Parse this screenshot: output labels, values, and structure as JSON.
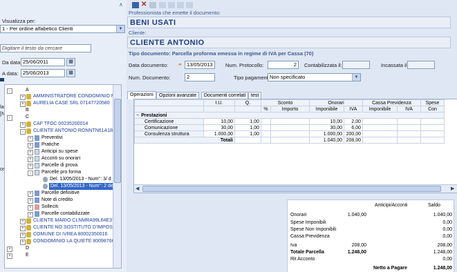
{
  "left": {
    "view_label": "Visualizza per:",
    "view_value": "1 - Per ordine alfabetico Clienti",
    "search_placeholder": "Digitare il testo da cercare",
    "from_label": "Da data:",
    "from_value": "25/06/2011",
    "to_label": "A data:",
    "to_value": "25/06/2013",
    "cut_labels": [
      "la",
      "[N",
      "oso"
    ],
    "tree": [
      {
        "text": "A",
        "blue": false
      },
      {
        "text": "AMMINISTRATORE CONDOMINIO M",
        "blue": true
      },
      {
        "text": "AURELIA CASE SRL  07147720580",
        "blue": true
      },
      {
        "text": "B",
        "blue": false
      },
      {
        "text": "C",
        "blue": false
      },
      {
        "text": "CAF TFDC  00235200014",
        "blue": true
      },
      {
        "text": "CLIENTE ANTONIO  RONNTN61A18",
        "blue": true
      },
      {
        "text": "Preventivi",
        "blue": false
      },
      {
        "text": "Pratiche",
        "blue": false
      },
      {
        "text": "Anticipi su spese",
        "blue": false
      },
      {
        "text": "Acconti su onorari",
        "blue": false
      },
      {
        "text": "Parcelle di prova",
        "blue": false
      },
      {
        "text": "Parcelle pro forma",
        "blue": false
      },
      {
        "text": "Del. 13/05/2013 - Num°: 3/ d",
        "blue": false
      },
      {
        "text": "Del. 13/05/2013 - Num°: 2 de",
        "blue": false,
        "selected": true
      },
      {
        "text": "Parcelle definitive",
        "blue": false
      },
      {
        "text": "Note di credito",
        "blue": false
      },
      {
        "text": "Solleciti",
        "blue": false
      },
      {
        "text": "Parcelle contabilizzate",
        "blue": false
      },
      {
        "text": "CLIENTE MARIO  CLNMRA99L64E37",
        "blue": true
      },
      {
        "text": "CLIENTE NO SOSTITUTO D'IMPOST",
        "blue": true
      },
      {
        "text": "COMUNE DI IVREA  80002350016",
        "blue": true
      },
      {
        "text": "CONDOMINIO LA QUIETE  8009876C",
        "blue": true
      },
      {
        "text": "D",
        "blue": false
      },
      {
        "text": "E",
        "blue": false
      }
    ]
  },
  "right": {
    "issuer_label": "Professionista che emette il documento:",
    "issuer_value": "BENI USATI",
    "client_label": "Cliente:",
    "client_value": "CLIENTE ANTONIO",
    "doc_type": "Tipo documento: Parcella proforma emessa in regime di IVA per Cassa (70)",
    "date_label": "Data documento:",
    "date_value": "13/05/2013",
    "protocol_label": "Num. Protocollo:",
    "protocol_value": "2",
    "accounted_label": "Contabilizzata il:",
    "collected_label": "Incassata il:",
    "docnum_label": "Num. Documento:",
    "docnum_value": "2",
    "payment_label": "Tipo pagamento:",
    "payment_value": "Non specificato",
    "tabs": [
      "Operazioni",
      "Opzioni avanzate",
      "Documenti correlati",
      "test"
    ],
    "grid": {
      "head1": [
        "",
        "I.U.",
        "Q.",
        "Sconto",
        "Onorari",
        "Cassa Previdenza",
        "Spese"
      ],
      "head2": [
        "",
        "",
        "",
        "%",
        "Importo",
        "Imponibile",
        "IVA",
        "Imponibile",
        "IVA",
        "Con"
      ],
      "section": "Prestazioni",
      "rows": [
        {
          "name": "Certificazione",
          "iu": "10,00",
          "q": "1,00",
          "imp": "10,00",
          "iva": "2,00"
        },
        {
          "name": "Comunicazione",
          "iu": "30,00",
          "q": "1,00",
          "imp": "30,00",
          "iva": "6,00"
        },
        {
          "name": "Consulenza struttura",
          "iu": "1.000,00",
          "q": "1,00",
          "imp": "1.000,00",
          "iva": "200,00"
        }
      ],
      "totals_label": "Totali",
      "totals_imp": "1.040,00",
      "totals_iva": "208,00"
    },
    "summary": {
      "col1": "Anticipi/Acconti",
      "col2": "Saldo",
      "rows": [
        {
          "label": "Onorari",
          "a": "1.040,00",
          "b": "",
          "c": "1.040,00",
          "bold": false
        },
        {
          "label": "Spese Imponibili",
          "a": "",
          "b": "",
          "c": "0,00",
          "bold": false
        },
        {
          "label": "Spese Non Imponibili",
          "a": "",
          "b": "",
          "c": "0,00",
          "bold": false
        },
        {
          "label": "Cassa Previdenza",
          "a": "",
          "b": "",
          "c": "0,00",
          "bold": false
        },
        {
          "label": "Iva",
          "a": "208,00",
          "b": "",
          "c": "208,00",
          "bold": false
        },
        {
          "label": "Totale Parcella",
          "a": "1.248,00",
          "b": "",
          "c": "1.248,00",
          "bold": true
        },
        {
          "label": "Rit Acconto",
          "a": "",
          "b": "",
          "c": "0,00",
          "bold": false
        }
      ],
      "net_label": "Netto a Pagare",
      "net_value": "1.248,00"
    }
  }
}
